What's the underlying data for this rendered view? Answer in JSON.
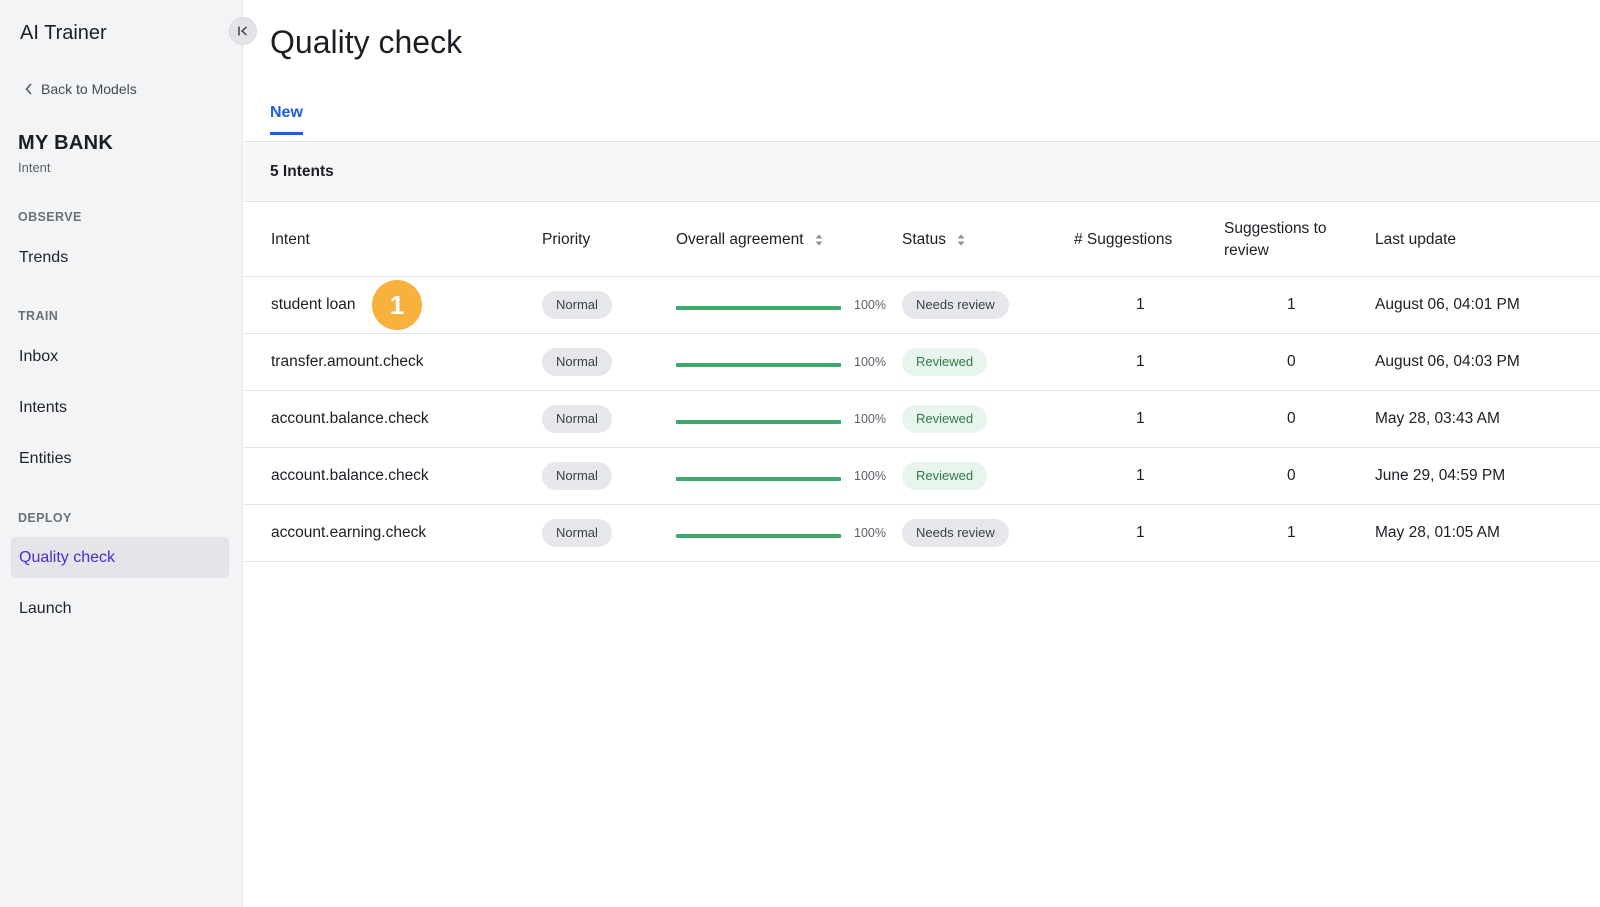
{
  "sidebar": {
    "app_title": "AI Trainer",
    "back_label": "Back to Models",
    "model_name": "MY BANK",
    "model_type": "Intent",
    "sections": {
      "observe": "OBSERVE",
      "train": "TRAIN",
      "deploy": "DEPLOY"
    },
    "items": {
      "trends": "Trends",
      "inbox": "Inbox",
      "intents": "Intents",
      "entities": "Entities",
      "quality_check": "Quality check",
      "launch": "Launch"
    },
    "active_item": "Quality check"
  },
  "main": {
    "title": "Quality check",
    "tab_new": "New",
    "count_text": "5 Intents",
    "columns": {
      "intent": "Intent",
      "priority": "Priority",
      "agreement": "Overall agreement",
      "status": "Status",
      "suggestions": "# Suggestions",
      "to_review": "Suggestions to review",
      "last_update": "Last update"
    },
    "rows": [
      {
        "intent": "student loan",
        "priority": "Normal",
        "agreement": "100%",
        "status": "Needs review",
        "suggestions": "1",
        "to_review": "1",
        "last_update": "August 06, 04:01 PM"
      },
      {
        "intent": "transfer.amount.check",
        "priority": "Normal",
        "agreement": "100%",
        "status": "Reviewed",
        "suggestions": "1",
        "to_review": "0",
        "last_update": "August 06, 04:03 PM"
      },
      {
        "intent": "account.balance.check",
        "priority": "Normal",
        "agreement": "100%",
        "status": "Reviewed",
        "suggestions": "1",
        "to_review": "0",
        "last_update": "May 28, 03:43 AM"
      },
      {
        "intent": "account.balance.check",
        "priority": "Normal",
        "agreement": "100%",
        "status": "Reviewed",
        "suggestions": "1",
        "to_review": "0",
        "last_update": "June 29, 04:59 PM"
      },
      {
        "intent": "account.earning.check",
        "priority": "Normal",
        "agreement": "100%",
        "status": "Needs review",
        "suggestions": "1",
        "to_review": "1",
        "last_update": "May 28, 01:05 AM"
      }
    ],
    "step_badge": "1"
  },
  "colors": {
    "accent": "#1d5fd6",
    "active_nav_text": "#4a2fd0",
    "agreement_bar": "#3da86b",
    "reviewed_text": "#2f7a48",
    "badge": "#f7b13c"
  },
  "icons": {
    "collapse": "collapse-left-icon",
    "back": "chevron-left-icon",
    "sort": "sort-icon"
  }
}
